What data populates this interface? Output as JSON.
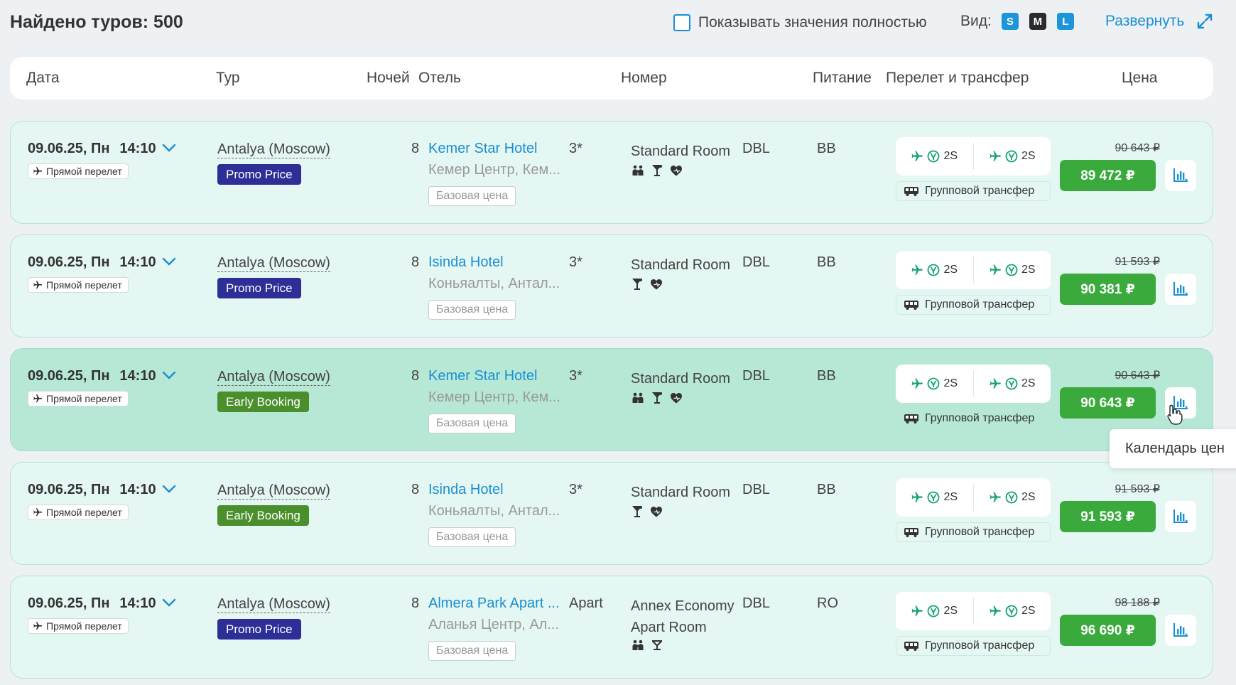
{
  "header": {
    "found_label": "Найдено туров: 500",
    "show_full_label": "Показывать значения полностью",
    "view_label": "Вид:",
    "view_sizes": [
      "S",
      "M",
      "L"
    ],
    "expand_label": "Развернуть"
  },
  "columns": {
    "date": "Дата",
    "tour": "Тур",
    "nights": "Ночей",
    "hotel": "Отель",
    "room": "Номер",
    "meal": "Питание",
    "flight": "Перелет и трансфер",
    "price": "Цена"
  },
  "rows": [
    {
      "date": "09.06.25, Пн",
      "time": "14:10",
      "direct_label": "Прямой перелет",
      "tour": "Antalya (Moscow)",
      "tag": "Promo Price",
      "nights": "8",
      "hotel": "Kemer Star Hotel",
      "location": "Кемер Центр, Кем...",
      "stars": "3*",
      "base_price_label": "Базовая цена",
      "room_line1": "Standard Room",
      "room_line2": "",
      "room_type": "DBL",
      "amenities": [
        "family-icon",
        "cocktail-icon",
        "heart-icon"
      ],
      "meal": "BB",
      "flight_there": "2S",
      "flight_back": "2S",
      "transfer": "Групповой трансфер",
      "old_price": "90 643 ₽",
      "price": "89 472 ₽"
    },
    {
      "date": "09.06.25, Пн",
      "time": "14:10",
      "direct_label": "Прямой перелет",
      "tour": "Antalya (Moscow)",
      "tag": "Promo Price",
      "nights": "8",
      "hotel": "Isinda Hotel",
      "location": "Коньяалты, Антал...",
      "stars": "3*",
      "base_price_label": "Базовая цена",
      "room_line1": "Standard Room",
      "room_line2": "",
      "room_type": "DBL",
      "amenities": [
        "cocktail-icon",
        "heart-icon"
      ],
      "meal": "BB",
      "flight_there": "2S",
      "flight_back": "2S",
      "transfer": "Групповой трансфер",
      "old_price": "91 593 ₽",
      "price": "90 381 ₽"
    },
    {
      "date": "09.06.25, Пн",
      "time": "14:10",
      "direct_label": "Прямой перелет",
      "tour": "Antalya (Moscow)",
      "tag": "Early Booking",
      "nights": "8",
      "hotel": "Kemer Star Hotel",
      "location": "Кемер Центр, Кем...",
      "stars": "3*",
      "base_price_label": "Базовая цена",
      "room_line1": "Standard Room",
      "room_line2": "",
      "room_type": "DBL",
      "amenities": [
        "family-icon",
        "cocktail-icon",
        "heart-icon"
      ],
      "meal": "BB",
      "flight_there": "2S",
      "flight_back": "2S",
      "transfer": "Групповой трансфер",
      "old_price": "90 643 ₽",
      "price": "90 643 ₽"
    },
    {
      "date": "09.06.25, Пн",
      "time": "14:10",
      "direct_label": "Прямой перелет",
      "tour": "Antalya (Moscow)",
      "tag": "Early Booking",
      "nights": "8",
      "hotel": "Isinda Hotel",
      "location": "Коньяалты, Антал...",
      "stars": "3*",
      "base_price_label": "Базовая цена",
      "room_line1": "Standard Room",
      "room_line2": "",
      "room_type": "DBL",
      "amenities": [
        "cocktail-icon",
        "heart-icon"
      ],
      "meal": "BB",
      "flight_there": "2S",
      "flight_back": "2S",
      "transfer": "Групповой трансфер",
      "old_price": "91 593 ₽",
      "price": "91 593 ₽"
    },
    {
      "date": "09.06.25, Пн",
      "time": "14:10",
      "direct_label": "Прямой перелет",
      "tour": "Antalya (Moscow)",
      "tag": "Promo Price",
      "nights": "8",
      "hotel": "Almera Park Apart ...",
      "location": "Аланья Центр, Ал...",
      "stars": "Apart",
      "base_price_label": "Базовая цена",
      "room_line1": "Annex Economy",
      "room_line2": "Apart Room",
      "room_type": "DBL",
      "amenities": [
        "family-icon",
        "lounge-icon"
      ],
      "meal": "RO",
      "flight_there": "2S",
      "flight_back": "2S",
      "transfer": "Групповой трансфер",
      "old_price": "98 188 ₽",
      "price": "96 690 ₽"
    }
  ],
  "tooltip": "Календарь цен",
  "colors": {
    "accent": "#1a8fd3",
    "price": "#3aaa3d",
    "promo": "#2d2f97",
    "early": "#4b8f2c",
    "flight_icon": "#16a27a"
  }
}
